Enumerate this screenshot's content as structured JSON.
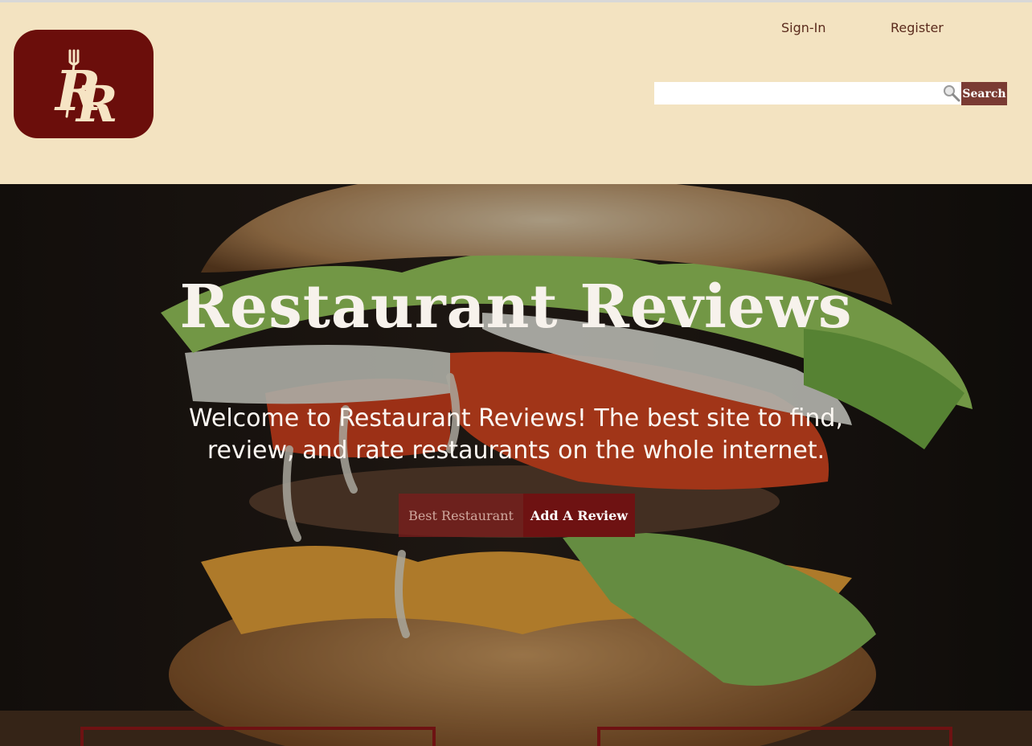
{
  "header": {
    "logo_text": "RR",
    "nav": {
      "signin_label": "Sign-In",
      "register_label": "Register"
    },
    "search": {
      "placeholder": "",
      "value": "",
      "button_label": "Search"
    }
  },
  "hero": {
    "title": "Restaurant Reviews",
    "subtitle": "Welcome to Restaurant Reviews! The best site to find, review, and rate restaurants on the whole internet.",
    "buttons": {
      "best_label": "Best Restaurant",
      "add_label": "Add A Review"
    }
  },
  "icons": {
    "logo": "rr-fork-logo-icon",
    "search": "magnifier-icon"
  },
  "colors": {
    "header_bg": "#f3e3c1",
    "brand_maroon": "#6b0e0b",
    "search_button": "#7a3b33",
    "hero_text": "#f7f2ec"
  }
}
